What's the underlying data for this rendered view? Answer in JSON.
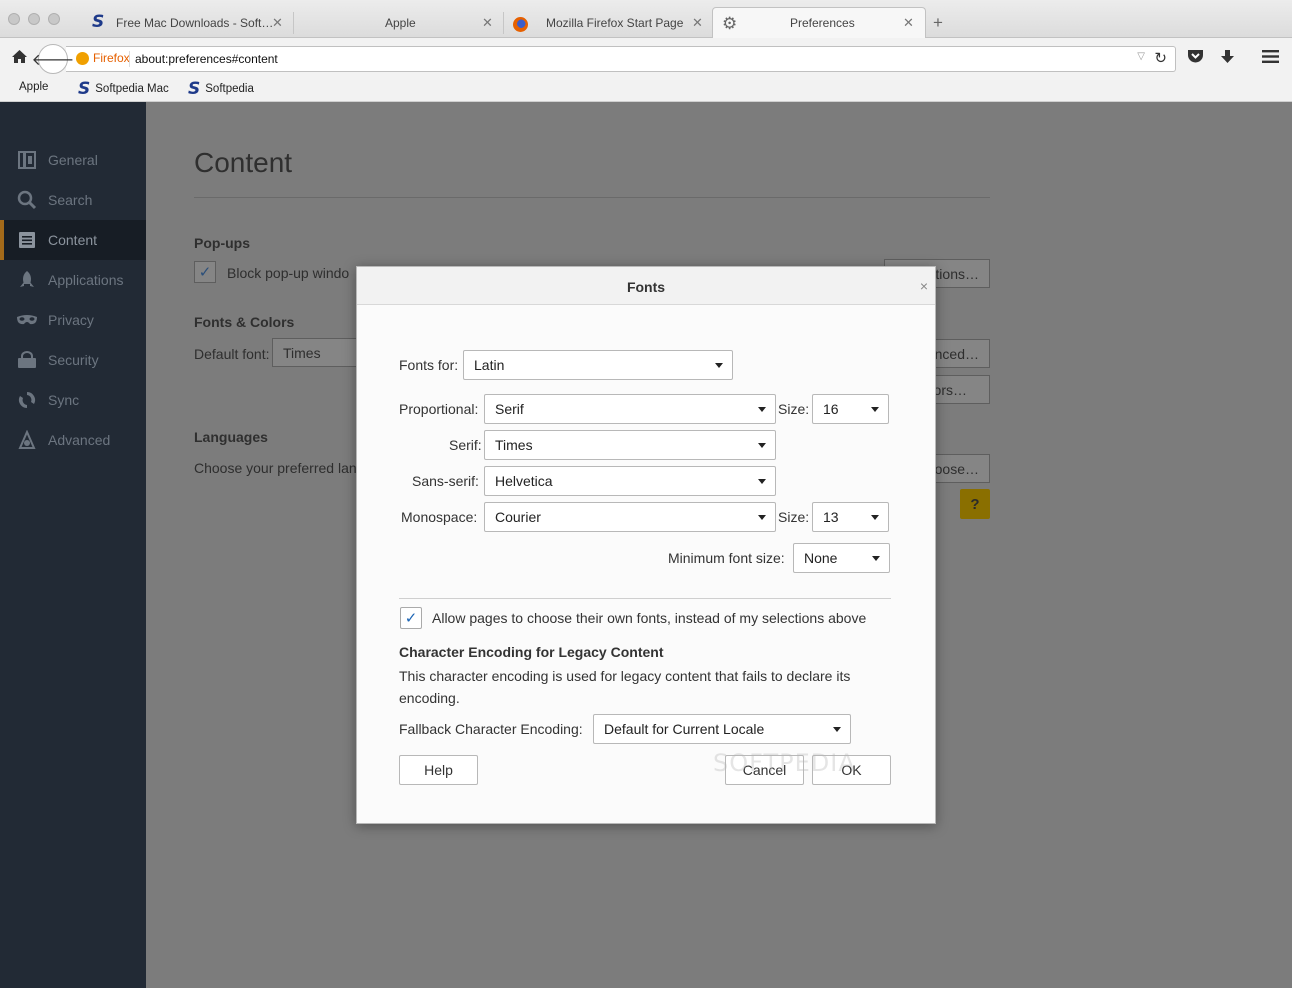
{
  "window": {
    "tabs": [
      {
        "title": "Free Mac Downloads - Soft…",
        "icon": "softpedia-icon"
      },
      {
        "title": "Apple",
        "icon": "apple-icon"
      },
      {
        "title": "Mozilla Firefox Start Page",
        "icon": "firefox-icon"
      },
      {
        "title": "Preferences",
        "icon": "gear-icon",
        "active": true
      }
    ],
    "new_tab": "+"
  },
  "navbar": {
    "identity": "Firefox",
    "url": "about:preferences#content"
  },
  "bookmarks": [
    {
      "label": "Apple",
      "icon": "apple-icon"
    },
    {
      "label": "Softpedia Mac",
      "icon": "softpedia-icon"
    },
    {
      "label": "Softpedia",
      "icon": "softpedia-icon"
    }
  ],
  "sidebar": {
    "items": [
      {
        "label": "General",
        "icon": "general-icon"
      },
      {
        "label": "Search",
        "icon": "search-icon"
      },
      {
        "label": "Content",
        "icon": "content-icon",
        "selected": true
      },
      {
        "label": "Applications",
        "icon": "applications-icon"
      },
      {
        "label": "Privacy",
        "icon": "privacy-icon"
      },
      {
        "label": "Security",
        "icon": "security-icon"
      },
      {
        "label": "Sync",
        "icon": "sync-icon"
      },
      {
        "label": "Advanced",
        "icon": "advanced-icon"
      }
    ]
  },
  "page": {
    "title": "Content",
    "popups_heading": "Pop-ups",
    "block_popups": "Block pop-up windo",
    "exceptions_btn": "tions…",
    "fonts_heading": "Fonts & Colors",
    "default_font_label": "Default font:",
    "default_font_value": "Times",
    "advanced_btn": "nced…",
    "colors_btn": "ors…",
    "languages_heading": "Languages",
    "languages_text": "Choose your preferred lan",
    "choose_btn": "oose…",
    "help_icon": "?"
  },
  "dialog": {
    "title": "Fonts",
    "close": "×",
    "fonts_for_label": "Fonts for:",
    "fonts_for_value": "Latin",
    "proportional_label": "Proportional:",
    "proportional_value": "Serif",
    "size_label": "Size:",
    "proportional_size": "16",
    "serif_label": "Serif:",
    "serif_value": "Times",
    "sans_label": "Sans-serif:",
    "sans_value": "Helvetica",
    "mono_label": "Monospace:",
    "mono_value": "Courier",
    "mono_size": "13",
    "min_size_label": "Minimum font size:",
    "min_size_value": "None",
    "allow_pages_label": "Allow pages to choose their own fonts, instead of my selections above",
    "allow_pages_checked": true,
    "encoding_heading": "Character Encoding for Legacy Content",
    "encoding_text": "This character encoding is used for legacy content that fails to declare its encoding.",
    "fallback_label": "Fallback Character Encoding:",
    "fallback_value": "Default for Current Locale",
    "help_btn": "Help",
    "cancel_btn": "Cancel",
    "ok_btn": "OK"
  },
  "watermark": "SOFTPEDIA",
  "colors": {
    "sidebar_bg": "#222a35",
    "accent": "#a36a1a",
    "checkmark": "#1e66b5"
  }
}
